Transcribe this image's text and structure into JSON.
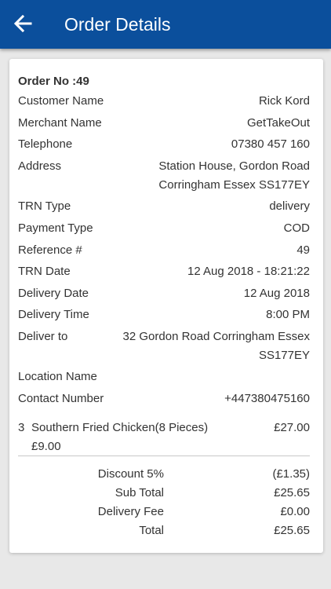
{
  "header": {
    "title": "Order Details",
    "bar_color": "#0b4f9c"
  },
  "order": {
    "order_no": "Order No :49",
    "fields": [
      {
        "label": "Customer Name",
        "value": "Rick Kord"
      },
      {
        "label": "Merchant Name",
        "value": "GetTakeOut"
      },
      {
        "label": "Telephone",
        "value": "07380 457 160"
      },
      {
        "label": "Address",
        "value": "Station House, Gordon Road",
        "value2": "Corringham Essex SS177EY"
      },
      {
        "label": "TRN Type",
        "value": "delivery"
      },
      {
        "label": "Payment Type",
        "value": "COD"
      },
      {
        "label": "Reference #",
        "value": "49"
      },
      {
        "label": "TRN Date",
        "value": "12 Aug 2018 - 18:21:22"
      },
      {
        "label": "Delivery Date",
        "value": "12 Aug 2018"
      },
      {
        "label": "Delivery Time",
        "value": "8:00 PM"
      },
      {
        "label": "Deliver to",
        "value": "32 Gordon Road Corringham Essex",
        "value2": "SS177EY"
      },
      {
        "label": "Location Name",
        "value": ""
      },
      {
        "label": "Contact Number",
        "value": "+447380475160"
      }
    ]
  },
  "items": [
    {
      "qty": "3",
      "name": "Southern Fried Chicken(8 Pieces)",
      "total": "£27.00",
      "unit_price": "£9.00"
    }
  ],
  "summary": [
    {
      "label": "Discount 5%",
      "value": "(£1.35)"
    },
    {
      "label": "Sub Total",
      "value": "£25.65"
    },
    {
      "label": "Delivery Fee",
      "value": "£0.00"
    },
    {
      "label": "Total",
      "value": "£25.65"
    }
  ]
}
